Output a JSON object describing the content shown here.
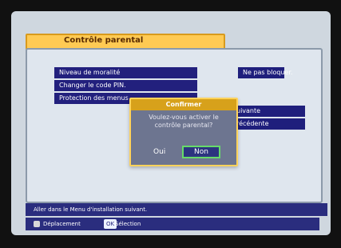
{
  "screen": {
    "title": "Contrôle parental"
  },
  "menu": {
    "items": [
      "Niveau de moralité",
      "Changer le code PIN.",
      "Protection des menus"
    ]
  },
  "right_panel": {
    "value": "Ne pas bloquer.",
    "next": "uivante",
    "previous": "récédente"
  },
  "dialog": {
    "title": "Confirmer",
    "message": "Voulez-vous activer le contrôle parental?",
    "yes": "Oui",
    "no": "Non"
  },
  "footer": {
    "info": "Aller dans le Menu d'installation suivant.",
    "hint_move": "Déplacement",
    "ok_key": "OK",
    "hint_select": "Sélection"
  }
}
